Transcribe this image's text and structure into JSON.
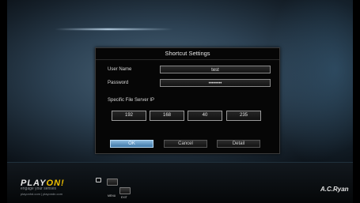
{
  "dialog": {
    "title": "Shortcut Settings",
    "user_name_label": "User Name",
    "user_name_value": "test",
    "password_label": "Password",
    "password_value": "••••••••",
    "server_ip_label": "Specific File Server IP",
    "ip": [
      "192",
      "168",
      "40",
      "235"
    ],
    "buttons": {
      "ok": "OK",
      "cancel": "Cancel",
      "detail": "Detail"
    }
  },
  "footer": {
    "logo_play": "PLAY",
    "logo_on": "ON!",
    "tagline": "engage your senses",
    "url": "playonhd.com | playondn.com",
    "menu_key": "MENU",
    "exit_key": "EXIT",
    "brand": "A.C.Ryan"
  },
  "colors": {
    "accent_button": "#5f98c6",
    "logo_highlight": "#f0c000"
  }
}
